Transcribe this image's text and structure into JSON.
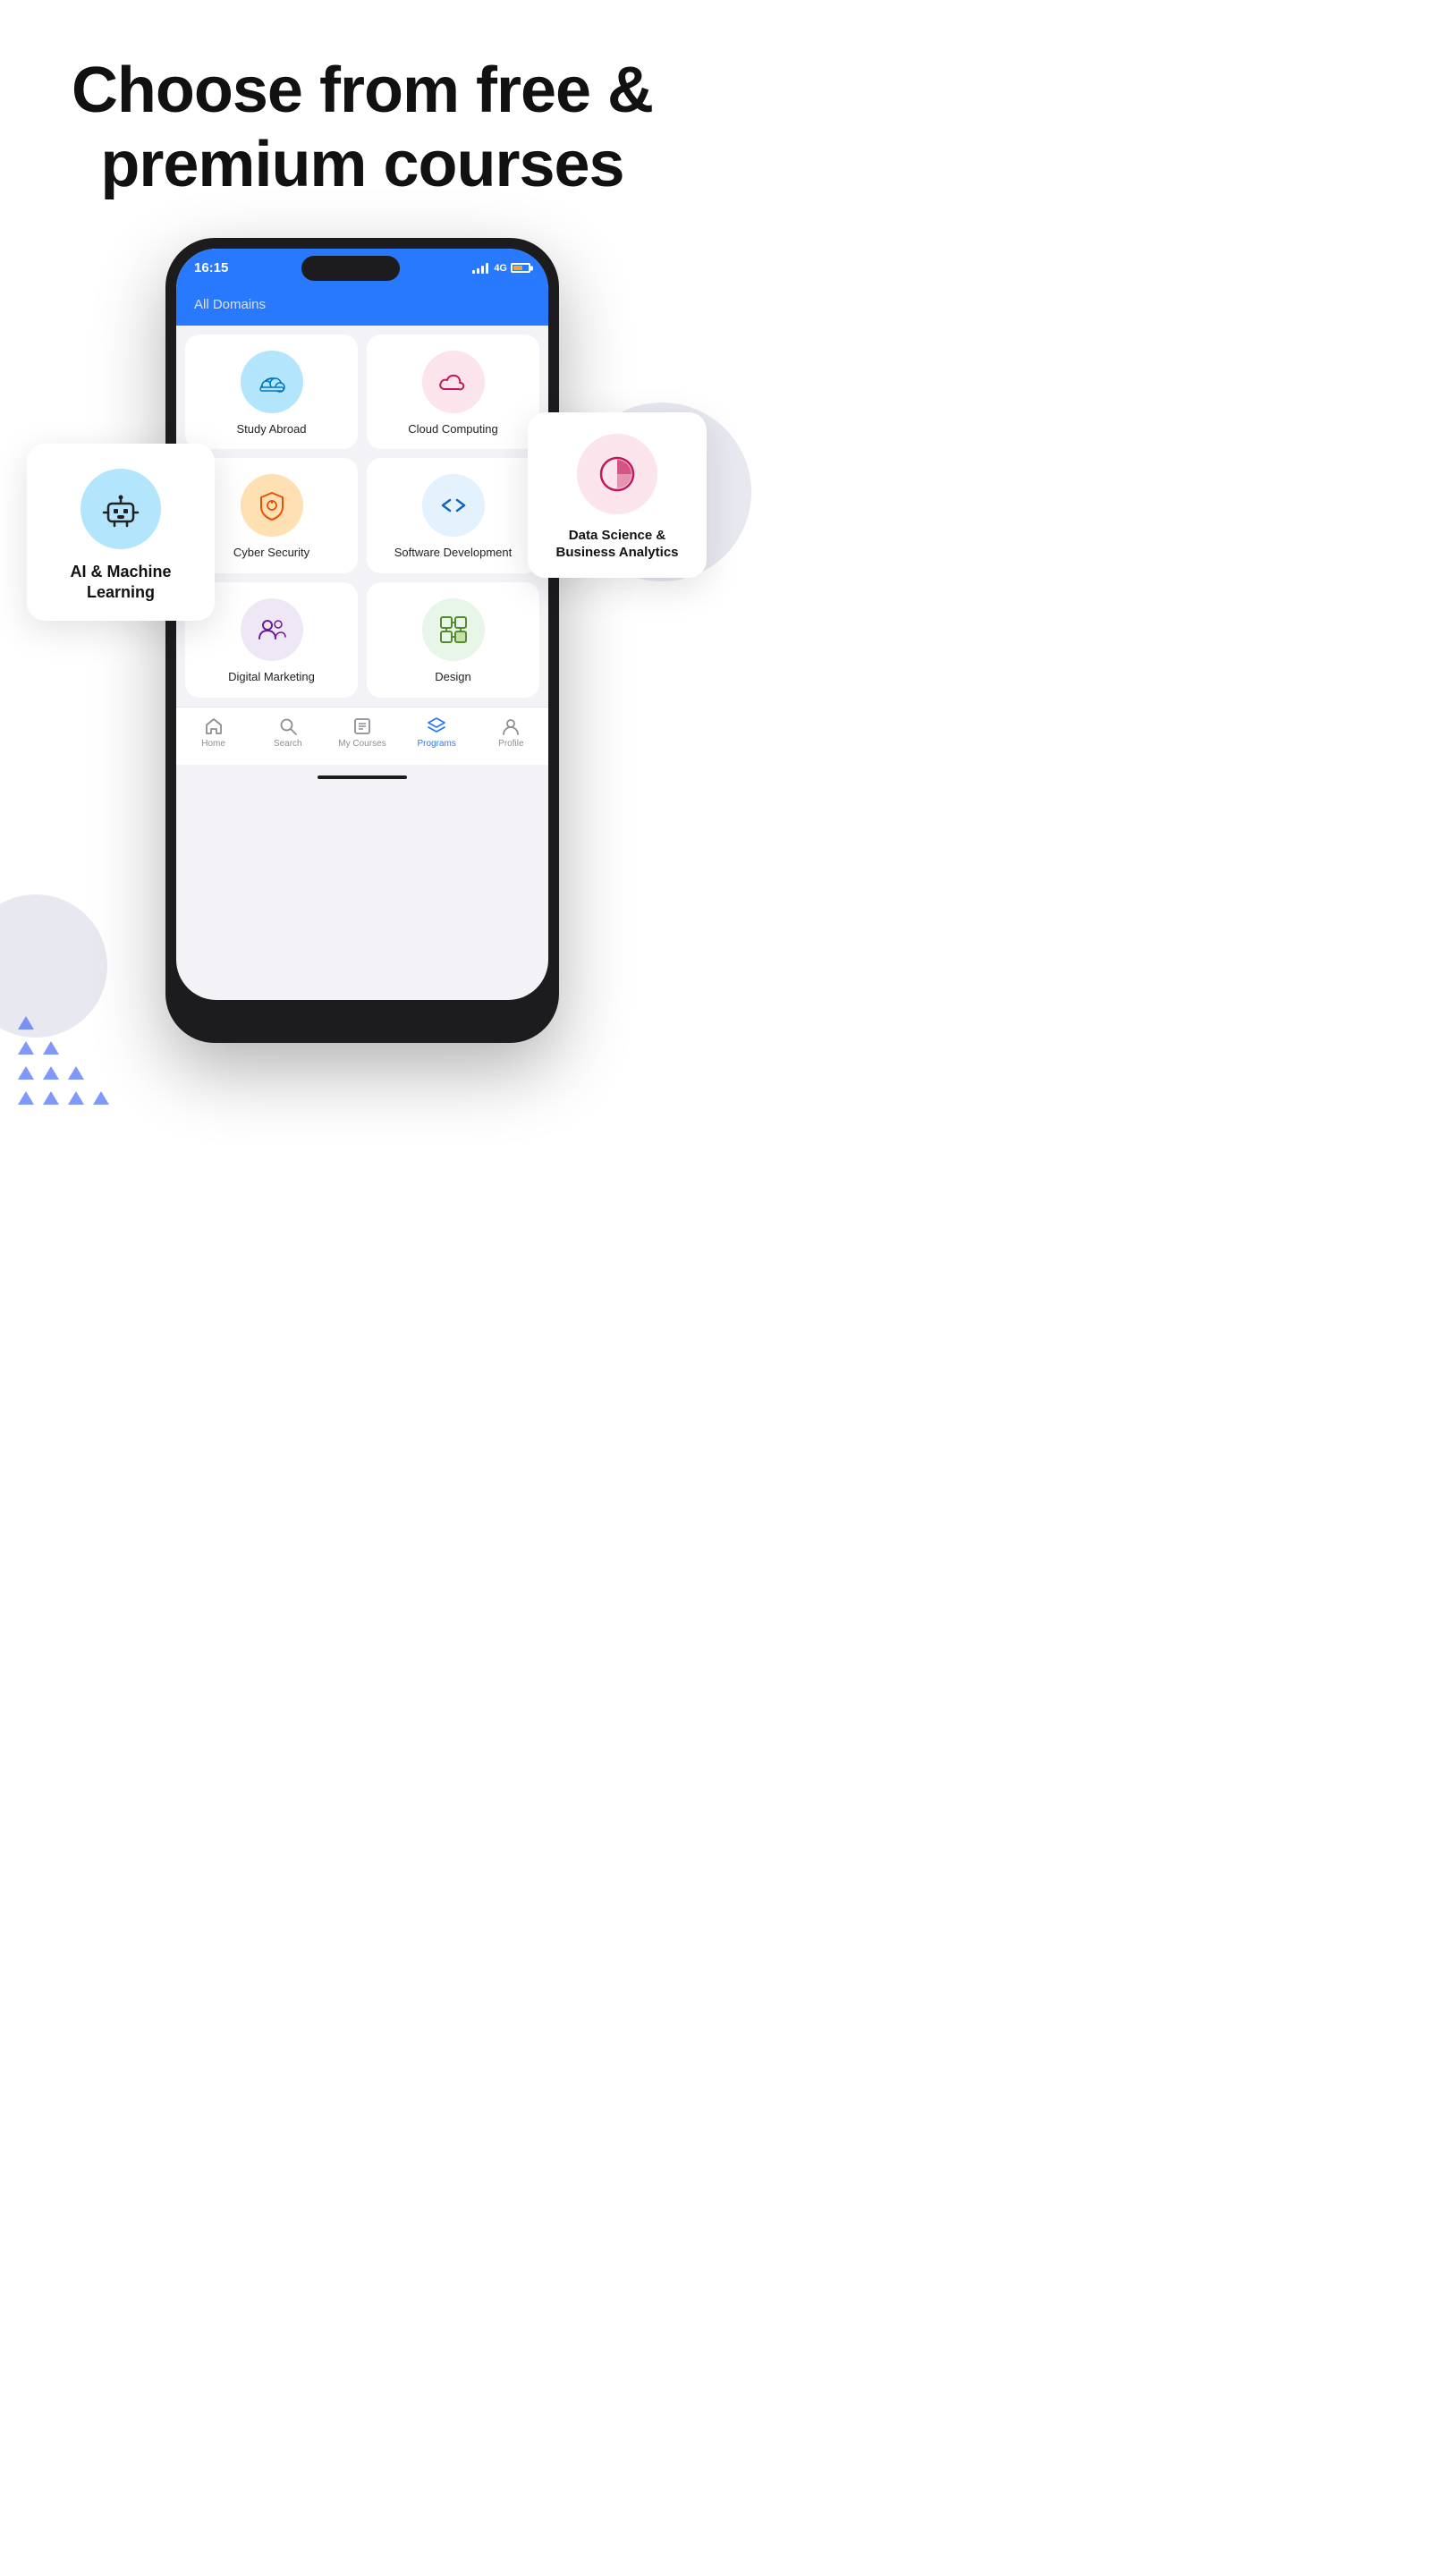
{
  "header": {
    "title": "Choose from free &\npremium courses"
  },
  "phone": {
    "statusBar": {
      "time": "16:15",
      "network": "4G"
    },
    "appHeader": {
      "label": "All Domains"
    },
    "floatingCards": {
      "ai": {
        "label": "AI & Machine\nLearning",
        "iconColor": "#b3e5fc",
        "iconBg": "#b3e5fc"
      },
      "dataScience": {
        "label": "Data Science &\nBusiness Analytics",
        "iconColor": "#fce4ec",
        "iconBg": "#fce4ec"
      }
    },
    "domains": [
      {
        "name": "Study Abroad",
        "iconBg": "#b3e5fc",
        "iconEmoji": "✈️"
      },
      {
        "name": "Cloud Computing",
        "iconBg": "#fce4ec",
        "iconEmoji": "☁️"
      },
      {
        "name": "Cyber Security",
        "iconBg": "#ffe0b2",
        "iconEmoji": "🛡️"
      },
      {
        "name": "Software\nDevelopment",
        "iconBg": "#e3f2fd",
        "iconEmoji": "⟨⟩"
      },
      {
        "name": "Digital Marketing",
        "iconBg": "#ede7f6",
        "iconEmoji": "👥"
      },
      {
        "name": "Design",
        "iconBg": "#f9fbe7",
        "iconEmoji": "🧩"
      }
    ],
    "bottomNav": [
      {
        "label": "Home",
        "active": false,
        "icon": "home"
      },
      {
        "label": "Search",
        "active": false,
        "icon": "search"
      },
      {
        "label": "My Courses",
        "active": false,
        "icon": "courses"
      },
      {
        "label": "Programs",
        "active": true,
        "icon": "programs"
      },
      {
        "label": "Profile",
        "active": false,
        "icon": "profile"
      }
    ]
  }
}
